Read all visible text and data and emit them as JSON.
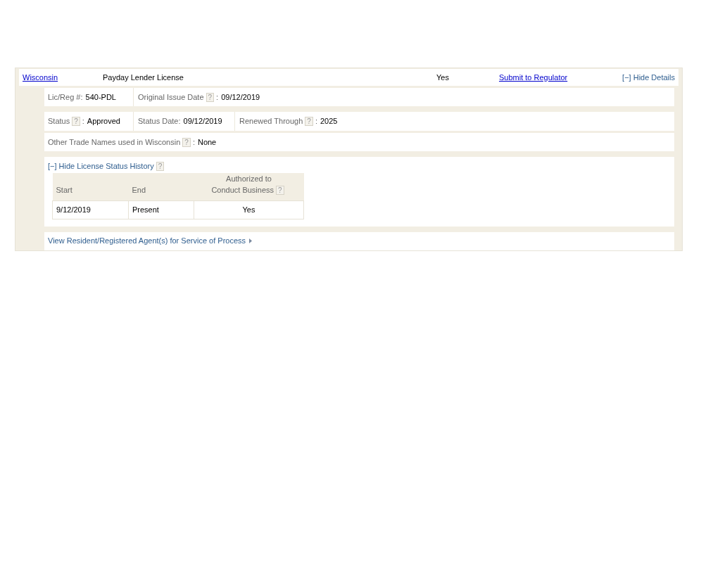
{
  "license": {
    "state": "Wisconsin",
    "type": "Payday Lender License",
    "value": "Yes",
    "submit_link": "Submit to Regulator",
    "toggle": {
      "mark": "[−]",
      "label": "Hide Details",
      "expanded": true
    }
  },
  "details": {
    "lic_reg": {
      "label": "Lic/Reg #:",
      "value": "540-PDL"
    },
    "original_issue": {
      "label": "Original Issue Date",
      "help": "?",
      "separator": ":",
      "value": "09/12/2019"
    },
    "status": {
      "label": "Status",
      "help": "?",
      "separator": ":",
      "value": "Approved"
    },
    "status_date": {
      "label": "Status Date:",
      "value": "09/12/2019"
    },
    "renewed": {
      "label": "Renewed Through",
      "help": "?",
      "separator": ":",
      "value": "2025"
    },
    "trade_names": {
      "label": "Other Trade Names used in Wisconsin",
      "help": "?",
      "separator": ":",
      "value": "None"
    }
  },
  "history": {
    "toggle": {
      "mark": "[−]",
      "label": "Hide License Status History",
      "expanded": true
    },
    "help": "?",
    "columns": [
      {
        "label": "Start"
      },
      {
        "label": "End"
      },
      {
        "label_lines": [
          "Authorized to",
          "Conduct Business"
        ],
        "help": "?"
      }
    ],
    "rows": [
      [
        "9/12/2019",
        "Present",
        "Yes"
      ]
    ]
  },
  "agents_link": "View Resident/Registered Agent(s) for Service of Process"
}
